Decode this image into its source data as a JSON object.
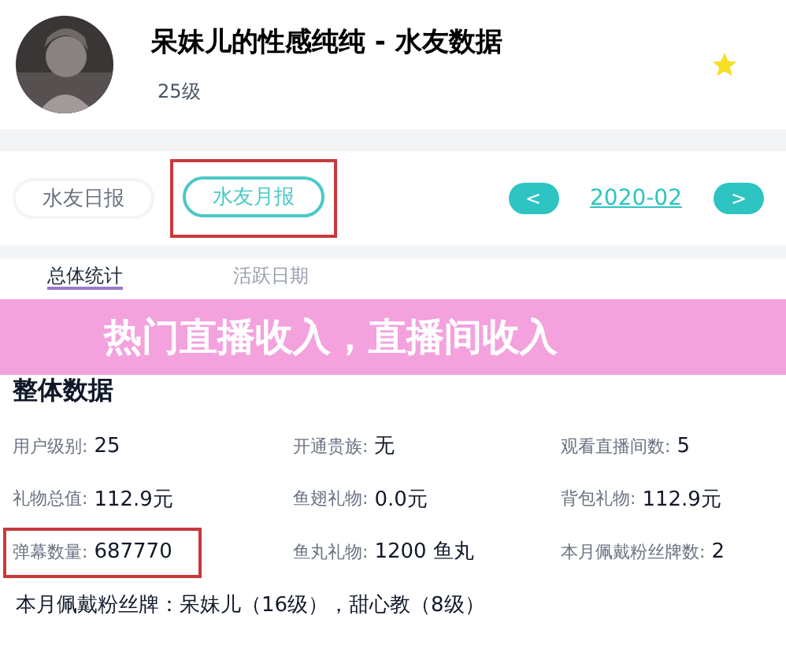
{
  "header": {
    "title": "呆妹儿的性感纯纯 - 水友数据",
    "level": "25级"
  },
  "report_tabs": [
    {
      "label": "水友日报",
      "selected": false,
      "highlighted": false
    },
    {
      "label": "水友月报",
      "selected": true,
      "highlighted": true
    }
  ],
  "month_nav": {
    "prev": "<",
    "month": "2020-02",
    "next": ">"
  },
  "section_tabs": [
    {
      "label": "总体统计",
      "selected": true
    },
    {
      "label": "活跃日期",
      "selected": false
    }
  ],
  "banner": "热门直播收入，直播间收入",
  "section_title": "整体数据",
  "stats": [
    {
      "label": "用户级别:",
      "value": "25",
      "highlighted": false
    },
    {
      "label": "开通贵族:",
      "value": "无",
      "highlighted": false
    },
    {
      "label": "观看直播间数:",
      "value": "5",
      "highlighted": false
    },
    {
      "label": "礼物总值:",
      "value": "112.9元",
      "highlighted": false
    },
    {
      "label": "鱼翅礼物:",
      "value": "0.0元",
      "highlighted": false
    },
    {
      "label": "背包礼物:",
      "value": "112.9元",
      "highlighted": false
    },
    {
      "label": "弹幕数量:",
      "value": "687770",
      "highlighted": true
    },
    {
      "label": "鱼丸礼物:",
      "value": "1200 鱼丸",
      "highlighted": false
    },
    {
      "label": "本月佩戴粉丝牌数:",
      "value": "2",
      "highlighted": false
    }
  ],
  "badges_line": "本月佩戴粉丝牌：呆妹儿（16级），甜心教（8级）"
}
